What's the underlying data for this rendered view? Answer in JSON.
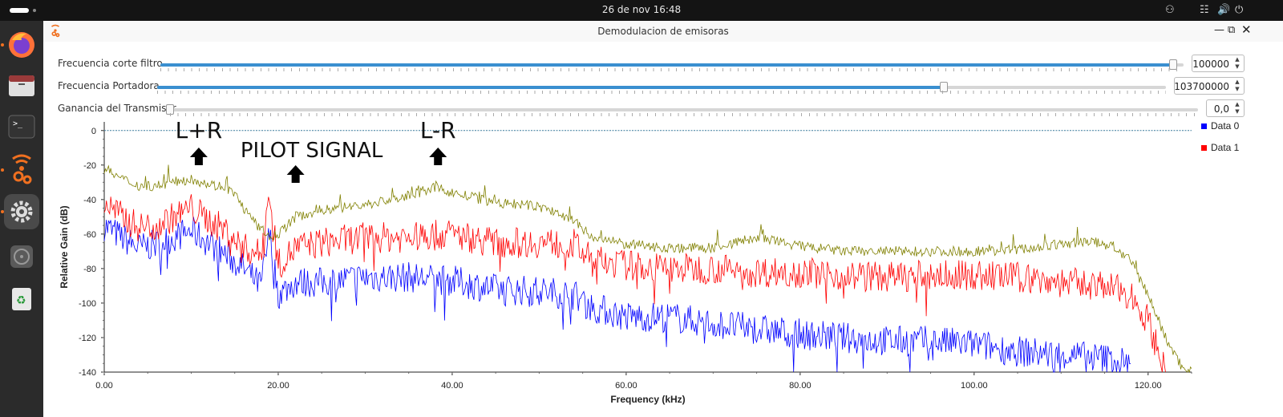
{
  "system": {
    "clock": "26 de nov  16:48",
    "tray_icons": [
      "accessibility-icon",
      "network-icon",
      "volume-icon",
      "power-icon"
    ]
  },
  "dock": {
    "items": [
      "firefox-icon",
      "files-icon",
      "terminal-icon",
      "gnuradio-icon",
      "settings-icon",
      "disc-icon",
      "trash-icon"
    ]
  },
  "window": {
    "title": "Demodulacion de emisoras",
    "app_icon": "gnuradio-icon"
  },
  "controls": [
    {
      "label": "Frecuencia corte filtro",
      "value": "100000",
      "position": 0.99
    },
    {
      "label": "Frecuencia Portadora",
      "value": "103700000",
      "position": 0.78
    },
    {
      "label": "Ganancia del Transmisor",
      "value": "0,0",
      "position": 0.0
    }
  ],
  "annotations": [
    {
      "text": "L+R",
      "x_khz": 10.5
    },
    {
      "text": "PILOT SIGNAL",
      "x_khz": 22.0
    },
    {
      "text": "L-R",
      "x_khz": 38.0
    }
  ],
  "chart_data": {
    "type": "line",
    "xlabel": "Frequency (kHz)",
    "ylabel": "Relative Gain (dB)",
    "xlim": [
      0,
      125
    ],
    "ylim": [
      -140,
      5
    ],
    "xticks": [
      "0.00",
      "20.00",
      "40.00",
      "60.00",
      "80.00",
      "100.00",
      "120.00"
    ],
    "yticks": [
      "0",
      "-20",
      "-40",
      "-60",
      "-80",
      "-100",
      "-120",
      "-140"
    ],
    "reference_line_db": 0,
    "legend_position": "right",
    "series": [
      {
        "name": "Data 0",
        "color": "#0000ff",
        "x": [
          0,
          2,
          4,
          6,
          8,
          10,
          12,
          14,
          16,
          18,
          19,
          20,
          22,
          25,
          30,
          35,
          40,
          45,
          50,
          54,
          56,
          60,
          65,
          70,
          75,
          80,
          85,
          90,
          95,
          100,
          105,
          110,
          115,
          118
        ],
        "y": [
          -55,
          -62,
          -68,
          -66,
          -62,
          -58,
          -65,
          -72,
          -80,
          -90,
          -60,
          -95,
          -88,
          -88,
          -85,
          -85,
          -87,
          -92,
          -93,
          -95,
          -102,
          -108,
          -108,
          -112,
          -115,
          -118,
          -120,
          -122,
          -122,
          -124,
          -128,
          -130,
          -132,
          -135
        ]
      },
      {
        "name": "Data 1",
        "color": "#ff0000",
        "x": [
          0,
          2,
          4,
          6,
          8,
          10,
          12,
          14,
          16,
          18,
          19,
          20,
          22,
          25,
          30,
          35,
          40,
          45,
          50,
          54,
          56,
          60,
          65,
          70,
          75,
          80,
          85,
          90,
          95,
          100,
          105,
          110,
          115,
          118,
          120,
          122
        ],
        "y": [
          -42,
          -50,
          -56,
          -55,
          -50,
          -45,
          -52,
          -58,
          -68,
          -72,
          -35,
          -78,
          -68,
          -65,
          -62,
          -62,
          -60,
          -65,
          -65,
          -66,
          -75,
          -78,
          -80,
          -80,
          -82,
          -82,
          -84,
          -85,
          -84,
          -84,
          -85,
          -88,
          -90,
          -95,
          -110,
          -140
        ]
      },
      {
        "name": "",
        "color": "#808000",
        "x": [
          0,
          2,
          4,
          6,
          8,
          10,
          12,
          14,
          15,
          17,
          19,
          20,
          22,
          25,
          30,
          35,
          38,
          40,
          45,
          50,
          54,
          56,
          60,
          65,
          70,
          75,
          80,
          85,
          90,
          95,
          100,
          105,
          110,
          113,
          116,
          118,
          120,
          122,
          124,
          125
        ],
        "y": [
          -22,
          -28,
          -32,
          -32,
          -30,
          -28,
          -31,
          -33,
          -37,
          -52,
          -62,
          -60,
          -50,
          -46,
          -43,
          -38,
          -33,
          -36,
          -42,
          -44,
          -52,
          -62,
          -66,
          -68,
          -68,
          -62,
          -67,
          -70,
          -70,
          -70,
          -70,
          -69,
          -66,
          -64,
          -67,
          -76,
          -95,
          -120,
          -138,
          -138
        ]
      }
    ]
  }
}
